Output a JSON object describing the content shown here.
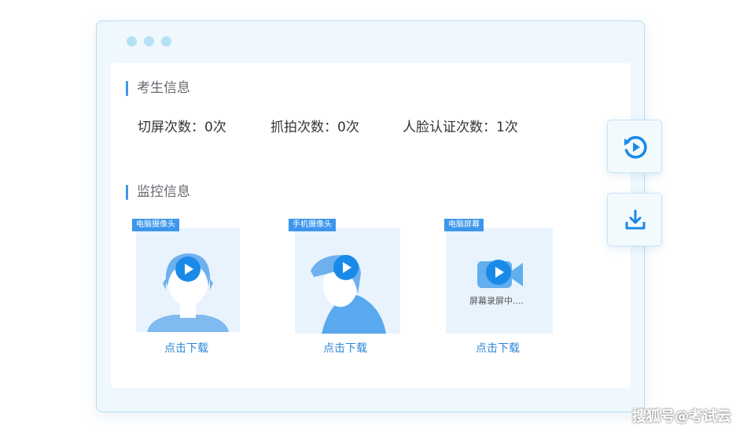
{
  "window": {
    "dots": 3
  },
  "exam_info": {
    "title": "考生信息",
    "stats": [
      "切屏次数：0次",
      "抓拍次数：0次",
      "人脸认证次数：1次"
    ]
  },
  "monitor_info": {
    "title": "监控信息",
    "cards": [
      {
        "tag": "电脑摄像头",
        "icon": "person-front-avatar",
        "link": "点击下载"
      },
      {
        "tag": "手机摄像头",
        "icon": "person-side-avatar",
        "link": "点击下载"
      },
      {
        "tag": "电脑屏幕",
        "icon": "video-camera-icon",
        "status": "屏幕录屏中....",
        "link": "点击下载"
      }
    ]
  },
  "side_buttons": [
    {
      "icon": "replay-icon"
    },
    {
      "icon": "download-icon"
    }
  ],
  "watermark": "搜狐号@考试云",
  "colors": {
    "accent": "#1a8ae8",
    "tag": "#3b96ec",
    "link": "#2a86d9",
    "window_bg": "#eef8fd"
  }
}
